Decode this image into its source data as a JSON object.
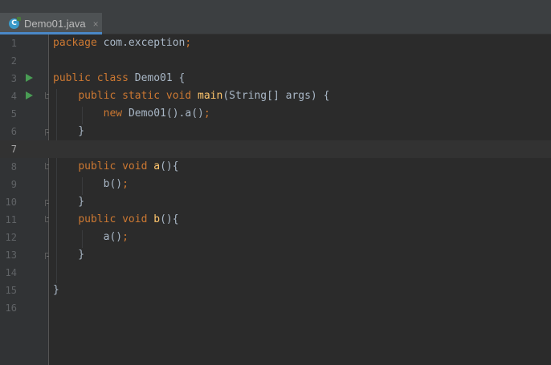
{
  "editor": {
    "tab": {
      "label": "Demo01.java",
      "close_label": "×",
      "icon": "java-class-icon"
    },
    "colors": {
      "background": "#2b2b2b",
      "gutter": "#313335",
      "keyword": "#cc7832",
      "plain": "#a9b7c6",
      "method": "#ffc66d",
      "line_number": "#606366",
      "run_icon": "#499c54",
      "tab_underline": "#4a88c7"
    },
    "current_line": 7,
    "lines": [
      {
        "num": "1",
        "tokens": [
          {
            "t": "kw",
            "v": "package "
          },
          {
            "t": "pl",
            "v": "com.exception"
          },
          {
            "t": "kw",
            "v": ";"
          }
        ]
      },
      {
        "num": "2",
        "tokens": []
      },
      {
        "num": "3",
        "run": true,
        "tokens": [
          {
            "t": "kw",
            "v": "public class "
          },
          {
            "t": "pl",
            "v": "Demo01 {"
          }
        ]
      },
      {
        "num": "4",
        "run": true,
        "fold": "open",
        "tokens": [
          {
            "t": "pl",
            "v": "    "
          },
          {
            "t": "kw",
            "v": "public static void "
          },
          {
            "t": "fn",
            "v": "main"
          },
          {
            "t": "pl",
            "v": "(String[] args) {"
          }
        ]
      },
      {
        "num": "5",
        "tokens": [
          {
            "t": "pl",
            "v": "        "
          },
          {
            "t": "kw",
            "v": "new "
          },
          {
            "t": "pl",
            "v": "Demo01().a()"
          },
          {
            "t": "kw",
            "v": ";"
          }
        ]
      },
      {
        "num": "6",
        "fold": "close",
        "tokens": [
          {
            "t": "pl",
            "v": "    }"
          }
        ]
      },
      {
        "num": "7",
        "tokens": []
      },
      {
        "num": "8",
        "fold": "open",
        "tokens": [
          {
            "t": "pl",
            "v": "    "
          },
          {
            "t": "kw",
            "v": "public void "
          },
          {
            "t": "fn",
            "v": "a"
          },
          {
            "t": "pl",
            "v": "(){"
          }
        ]
      },
      {
        "num": "9",
        "tokens": [
          {
            "t": "pl",
            "v": "        b()"
          },
          {
            "t": "kw",
            "v": ";"
          }
        ]
      },
      {
        "num": "10",
        "fold": "close",
        "tokens": [
          {
            "t": "pl",
            "v": "    }"
          }
        ]
      },
      {
        "num": "11",
        "fold": "open",
        "tokens": [
          {
            "t": "pl",
            "v": "    "
          },
          {
            "t": "kw",
            "v": "public void "
          },
          {
            "t": "fn",
            "v": "b"
          },
          {
            "t": "pl",
            "v": "(){"
          }
        ]
      },
      {
        "num": "12",
        "tokens": [
          {
            "t": "pl",
            "v": "        a()"
          },
          {
            "t": "kw",
            "v": ";"
          }
        ]
      },
      {
        "num": "13",
        "fold": "close",
        "tokens": [
          {
            "t": "pl",
            "v": "    }"
          }
        ]
      },
      {
        "num": "14",
        "tokens": []
      },
      {
        "num": "15",
        "tokens": [
          {
            "t": "pl",
            "v": "}"
          }
        ]
      },
      {
        "num": "16",
        "tokens": []
      }
    ]
  }
}
